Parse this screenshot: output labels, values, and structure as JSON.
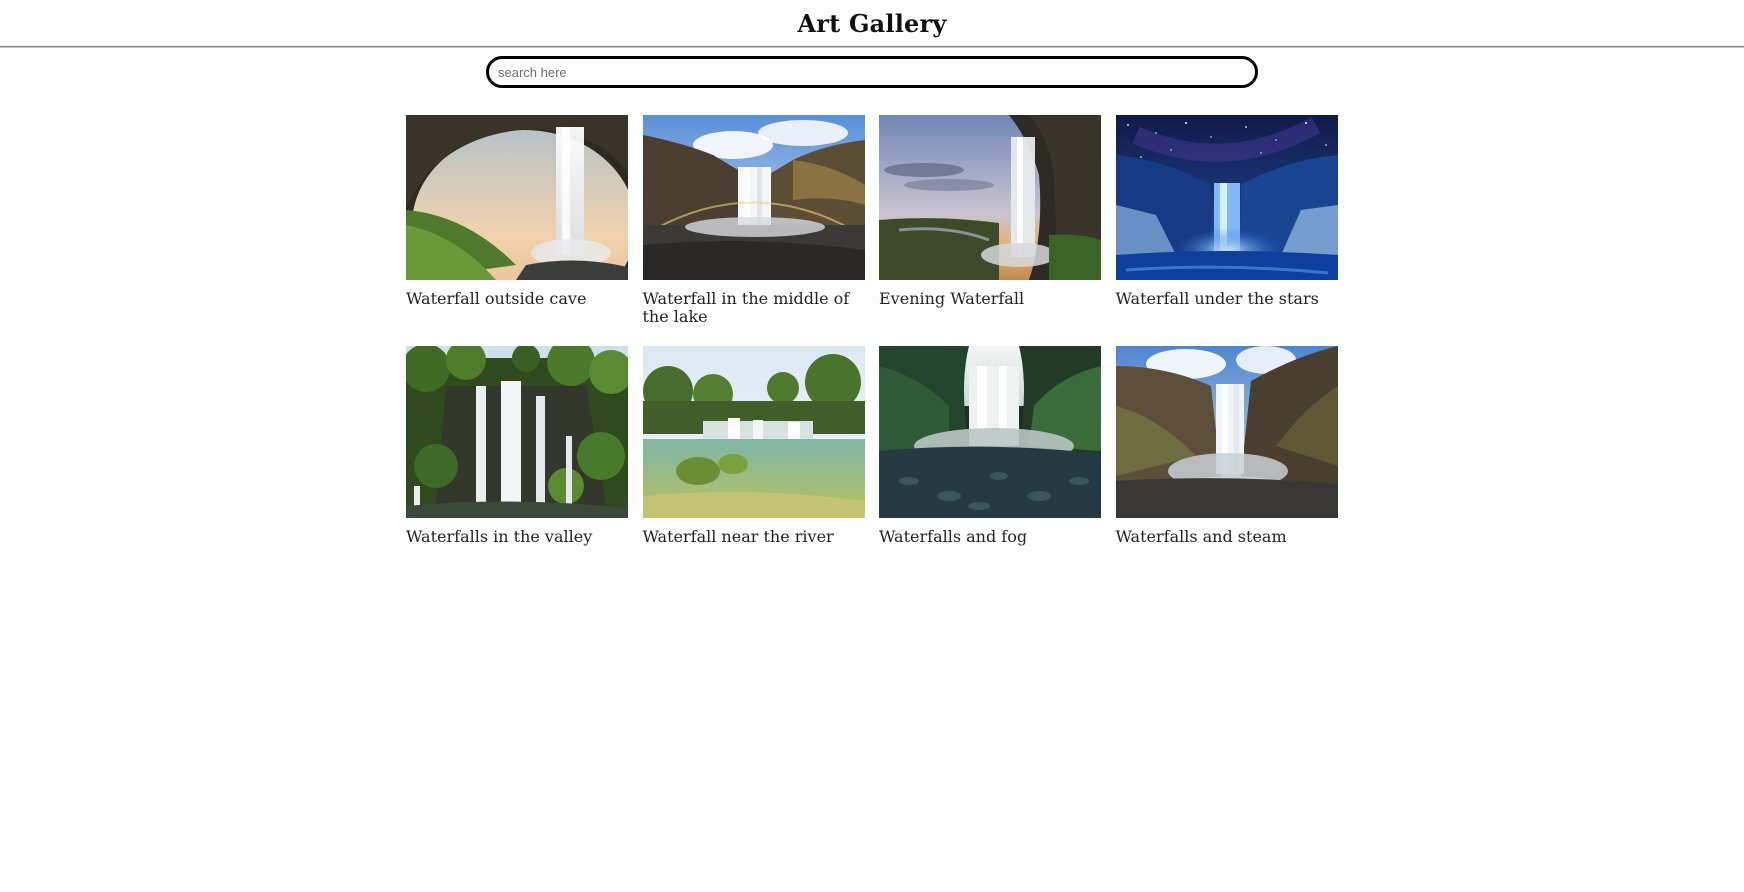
{
  "header": {
    "title": "Art Gallery"
  },
  "search": {
    "placeholder": "search here",
    "value": ""
  },
  "gallery": {
    "items": [
      {
        "caption": "Waterfall outside cave",
        "scene": "cave"
      },
      {
        "caption": "Waterfall in the middle of the lake",
        "scene": "rainbow"
      },
      {
        "caption": "Evening Waterfall",
        "scene": "evening"
      },
      {
        "caption": "Waterfall under the stars",
        "scene": "stars"
      },
      {
        "caption": "Waterfalls in the valley",
        "scene": "valley"
      },
      {
        "caption": "Waterfall near the river",
        "scene": "river"
      },
      {
        "caption": "Waterfalls and fog",
        "scene": "fog"
      },
      {
        "caption": "Waterfalls and steam",
        "scene": "steam"
      }
    ]
  }
}
